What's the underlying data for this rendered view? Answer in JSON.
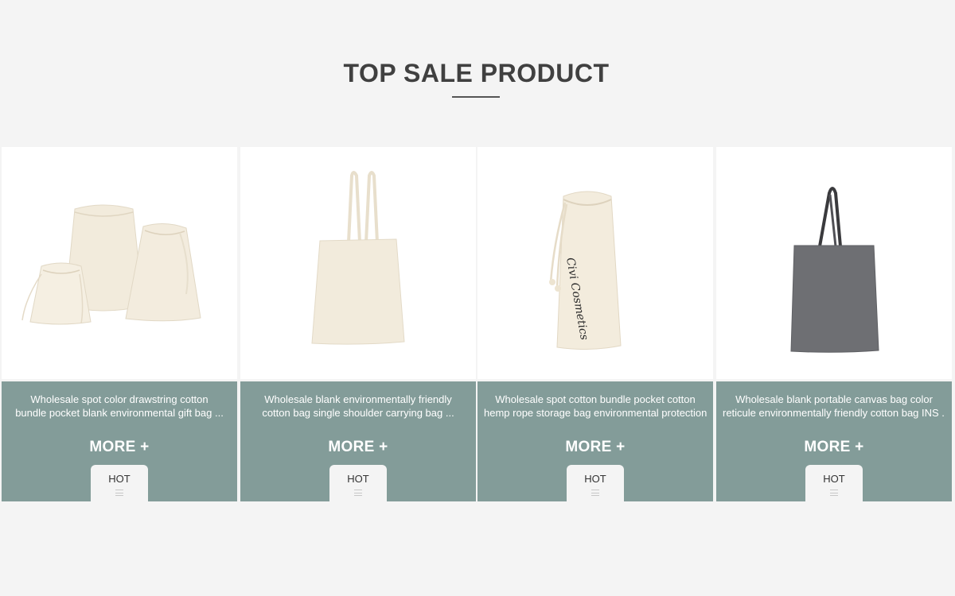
{
  "section": {
    "title": "TOP SALE PRODUCT"
  },
  "products": [
    {
      "desc_line1": "Wholesale spot color drawstring cotton",
      "desc_line2": "bundle pocket blank environmental gift bag ...",
      "more_label": "MORE +",
      "badge": "HOT",
      "image_icon": "drawstring-pouches-image"
    },
    {
      "desc_line1": "Wholesale blank environmentally friendly",
      "desc_line2": "cotton bag single shoulder carrying bag ...",
      "more_label": "MORE +",
      "badge": "HOT",
      "image_icon": "cream-tote-bag-image"
    },
    {
      "desc_line1": "Wholesale spot cotton bundle pocket cotton",
      "desc_line2": "hemp rope storage bag environmental protection ...",
      "more_label": "MORE +",
      "badge": "HOT",
      "image_icon": "cosmetics-drawstring-bag-image",
      "print_text": "Civi Cosmetics"
    },
    {
      "desc_line1": "Wholesale blank portable canvas bag color",
      "desc_line2": "reticule environmentally friendly cotton bag INS ...",
      "more_label": "MORE +",
      "badge": "HOT",
      "image_icon": "gray-tote-bag-image"
    }
  ],
  "colors": {
    "page_bg": "#f4f4f4",
    "info_panel": "#839c99",
    "title_text": "#404040",
    "canvas_cream": "#f2ebdc",
    "gray_tote": "#6e6f73"
  }
}
